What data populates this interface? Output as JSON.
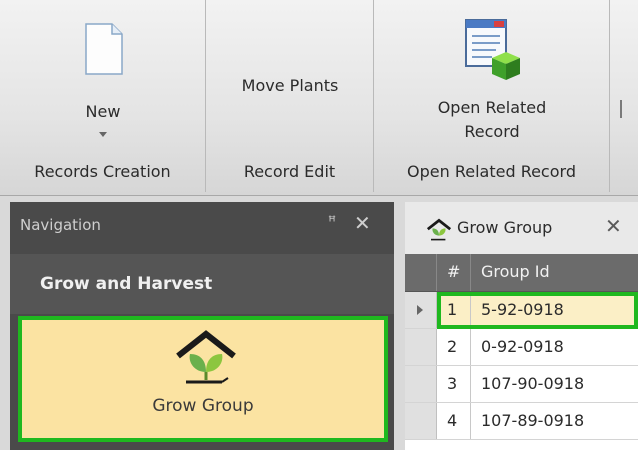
{
  "ribbon": {
    "groups": [
      {
        "label": "Records Creation",
        "button": {
          "label": "New",
          "icon": "new-document-icon",
          "has_dropdown": true
        }
      },
      {
        "label": "Record Edit",
        "button": {
          "label": "Move Plants"
        }
      },
      {
        "label": "Open Related Record",
        "button": {
          "label_line1": "Open Related",
          "label_line2": "Record",
          "icon": "open-related-record-icon"
        }
      }
    ]
  },
  "navigation": {
    "title": "Navigation",
    "pin_glyph": "ꟸ",
    "close_glyph": "✕",
    "section": "Grow and Harvest",
    "item": {
      "label": "Grow Group",
      "icon": "grow-group-icon"
    }
  },
  "document": {
    "tab": {
      "label": "Grow Group",
      "close_glyph": "✕",
      "icon": "grow-group-icon"
    },
    "grid": {
      "columns": [
        "#",
        "Group Id"
      ],
      "rows": [
        {
          "num": "1",
          "group_id": "5-92-0918",
          "selected": true
        },
        {
          "num": "2",
          "group_id": "0-92-0918"
        },
        {
          "num": "3",
          "group_id": "107-90-0918"
        },
        {
          "num": "4",
          "group_id": "107-89-0918"
        }
      ]
    }
  },
  "colors": {
    "highlight": "#1fb81f",
    "nav_selected": "#fbe3a2",
    "row_selected": "#fbefc6"
  }
}
